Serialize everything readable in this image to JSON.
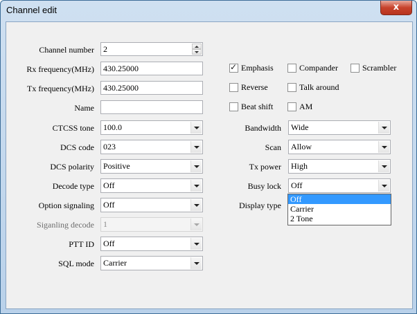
{
  "window": {
    "title": "Channel edit",
    "close_label": "x"
  },
  "left": {
    "channel_number": {
      "label": "Channel number",
      "value": "2"
    },
    "rx_freq": {
      "label": "Rx frequency(MHz)",
      "value": "430.25000"
    },
    "tx_freq": {
      "label": "Tx frequency(MHz)",
      "value": "430.25000"
    },
    "name": {
      "label": "Name",
      "value": ""
    },
    "ctcss": {
      "label": "CTCSS tone",
      "value": "100.0"
    },
    "dcs_code": {
      "label": "DCS code",
      "value": "023"
    },
    "dcs_polarity": {
      "label": "DCS polarity",
      "value": "Positive"
    },
    "decode_type": {
      "label": "Decode type",
      "value": "Off"
    },
    "option_signaling": {
      "label": "Option signaling",
      "value": "Off"
    },
    "signaling_decode": {
      "label": "Siganling decode",
      "value": "1"
    },
    "ptt_id": {
      "label": "PTT ID",
      "value": "Off"
    },
    "sql_mode": {
      "label": "SQL mode",
      "value": "Carrier"
    }
  },
  "checkboxes": {
    "emphasis": {
      "label": "Emphasis",
      "checked": true,
      "mark": "✓"
    },
    "compander": {
      "label": "Compander",
      "checked": false
    },
    "scrambler": {
      "label": "Scrambler",
      "checked": false
    },
    "reverse": {
      "label": "Reverse",
      "checked": false
    },
    "talk_around": {
      "label": "Talk around",
      "checked": false
    },
    "beat_shift": {
      "label": "Beat shift",
      "checked": false
    },
    "am": {
      "label": "AM",
      "checked": false
    }
  },
  "right": {
    "bandwidth": {
      "label": "Bandwidth",
      "value": "Wide"
    },
    "scan": {
      "label": "Scan",
      "value": "Allow"
    },
    "tx_power": {
      "label": "Tx power",
      "value": "High"
    },
    "busy_lock": {
      "label": "Busy lock",
      "value": "Off"
    },
    "display_type": {
      "label": "Display type"
    }
  },
  "busy_lock_dropdown": {
    "options": [
      "Off",
      "Carrier",
      "2 Tone"
    ],
    "selected": "Off"
  }
}
